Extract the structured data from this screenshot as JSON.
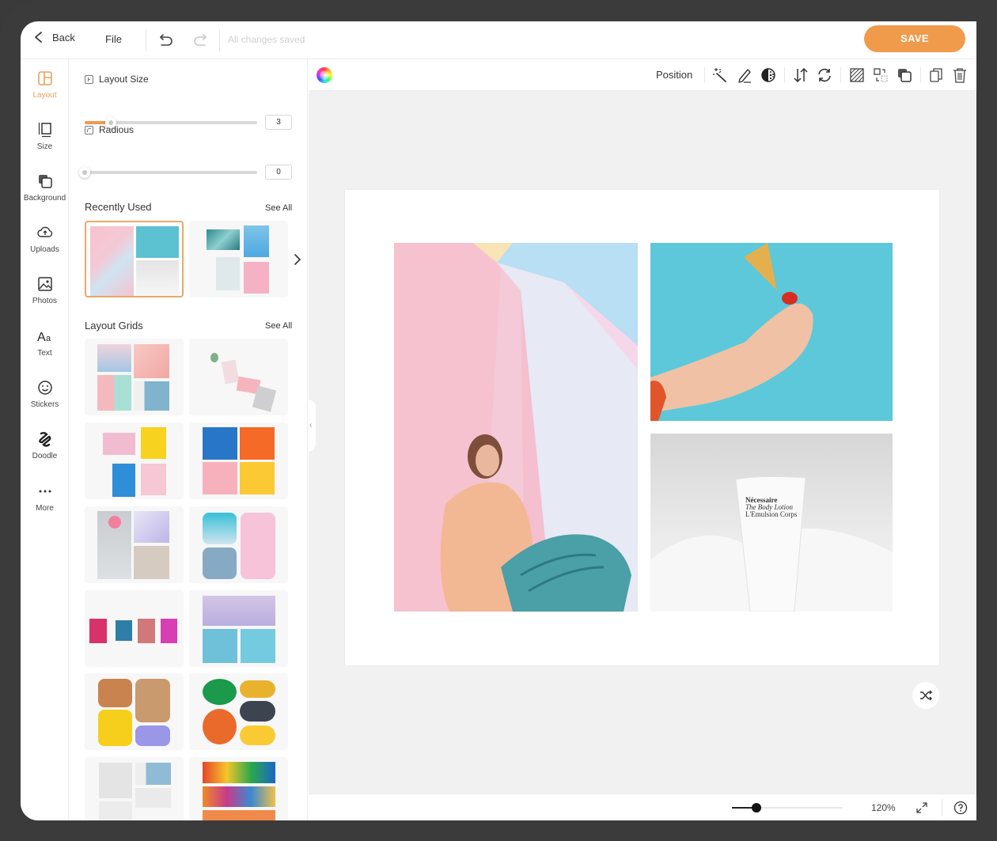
{
  "topbar": {
    "back_label": "Back",
    "file_label": "File",
    "status": "All changes saved",
    "save_label": "SAVE",
    "accent": "#f09a4c"
  },
  "rail": {
    "items": [
      {
        "label": "Layout",
        "icon": "layout-icon",
        "active": true
      },
      {
        "label": "Size",
        "icon": "size-icon"
      },
      {
        "label": "Background",
        "icon": "background-icon"
      },
      {
        "label": "Uploads",
        "icon": "cloud-upload-icon"
      },
      {
        "label": "Photos",
        "icon": "image-icon"
      },
      {
        "label": "Text",
        "icon": "text-icon"
      },
      {
        "label": "Stickers",
        "icon": "smiley-icon"
      },
      {
        "label": "Doodle",
        "icon": "doodle-icon"
      },
      {
        "label": "More",
        "icon": "more-dots-icon"
      }
    ]
  },
  "panel": {
    "layout_size": {
      "label": "Layout Size",
      "value": "3",
      "fraction": 0.15
    },
    "radius": {
      "label": "Radious",
      "value": "0",
      "fraction": 0.0
    },
    "recently_used": {
      "title": "Recently Used",
      "see_all": "See All"
    },
    "layout_grids": {
      "title": "Layout Grids",
      "see_all": "See All"
    }
  },
  "canvas_toolbar": {
    "position_label": "Position",
    "tools": [
      "magic-wand-icon",
      "pencil-icon",
      "halftone-icon",
      "flip-vertical-icon",
      "rotate-icon",
      "hatch-pattern-icon",
      "swap-icon",
      "layers-icon",
      "duplicate-icon",
      "trash-icon"
    ]
  },
  "canvas": {
    "product_text_line1": "Nécessaire",
    "product_text_line2": "The Body Lotion",
    "product_text_line3": "L'Emulsion Corps"
  },
  "bottombar": {
    "zoom_label": "120%",
    "zoom_fraction": 0.22
  }
}
